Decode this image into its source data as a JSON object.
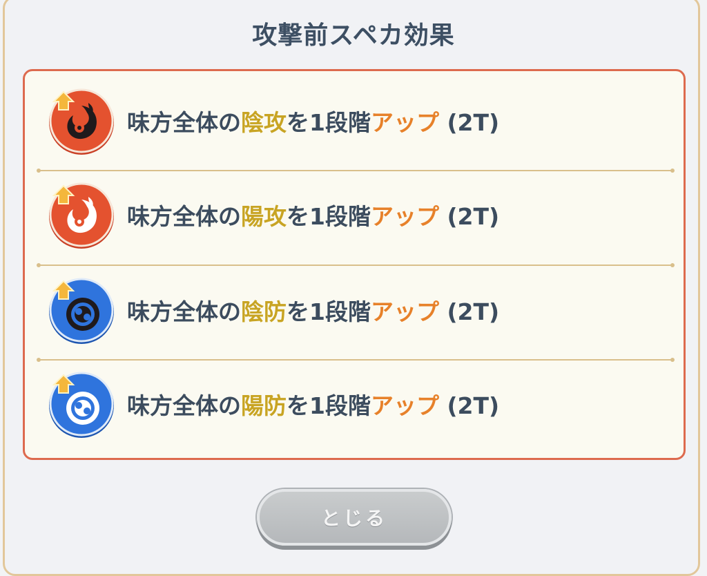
{
  "dialog": {
    "title": "攻撃前スペカ効果",
    "close_label": "とじる"
  },
  "effects": [
    {
      "prefix": "味方全体の",
      "stat": "陰攻",
      "middle": "を1段階",
      "change": "アップ",
      "duration": " (2T)",
      "icon": "yin-attack-up-icon"
    },
    {
      "prefix": "味方全体の",
      "stat": "陽攻",
      "middle": "を1段階",
      "change": "アップ",
      "duration": " (2T)",
      "icon": "yang-attack-up-icon"
    },
    {
      "prefix": "味方全体の",
      "stat": "陰防",
      "middle": "を1段階",
      "change": "アップ",
      "duration": " (2T)",
      "icon": "yin-defense-up-icon"
    },
    {
      "prefix": "味方全体の",
      "stat": "陽防",
      "middle": "を1段階",
      "change": "アップ",
      "duration": " (2T)",
      "icon": "yang-defense-up-icon"
    }
  ],
  "colors": {
    "panel_border": "#dd6a4e",
    "stat_text": "#c8a423",
    "change_text": "#e7812a",
    "attack_icon": "#e4522f",
    "defense_icon": "#2f74dd"
  }
}
